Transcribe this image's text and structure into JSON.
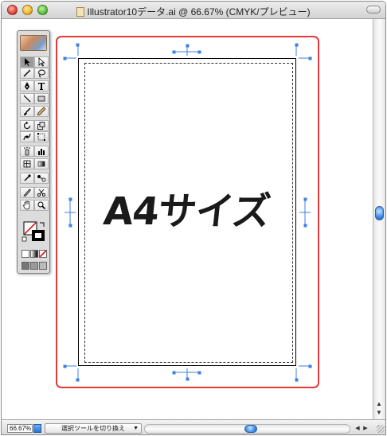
{
  "window": {
    "title": "Illustrator10データ.ai @ 66.67% (CMYK/プレビュー)"
  },
  "canvas": {
    "artwork_text": "A4サイズ"
  },
  "status_bar": {
    "zoom_value": "66.67%",
    "status_select": "選択ツールを切り換え"
  },
  "colors": {
    "page_frame": "#e33b3b",
    "trim_marks": "#3f7fe0",
    "scroll_thumb": "#3f8ee8"
  }
}
